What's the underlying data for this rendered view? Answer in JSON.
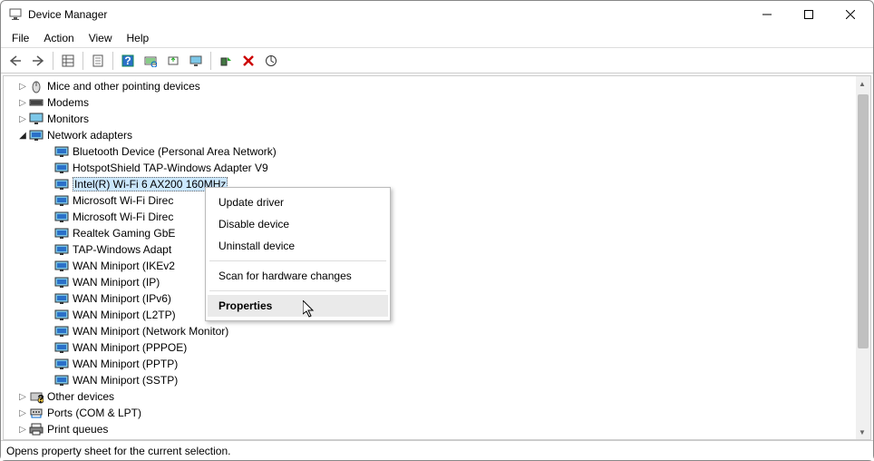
{
  "window": {
    "title": "Device Manager"
  },
  "menu": {
    "file": "File",
    "action": "Action",
    "view": "View",
    "help": "Help"
  },
  "tree": {
    "categories": [
      {
        "label": "Mice and other pointing devices",
        "expanded": false,
        "icon": "mouse"
      },
      {
        "label": "Modems",
        "expanded": false,
        "icon": "modem"
      },
      {
        "label": "Monitors",
        "expanded": false,
        "icon": "monitor"
      },
      {
        "label": "Network adapters",
        "expanded": true,
        "icon": "network",
        "children": [
          {
            "label": "Bluetooth Device (Personal Area Network)"
          },
          {
            "label": "HotspotShield TAP-Windows Adapter V9"
          },
          {
            "label": "Intel(R) Wi-Fi 6 AX200 160MHz",
            "selected": true
          },
          {
            "label": "Microsoft Wi-Fi Direc",
            "truncated": true
          },
          {
            "label": "Microsoft Wi-Fi Direc",
            "truncated": true
          },
          {
            "label": "Realtek Gaming GbE"
          },
          {
            "label": "TAP-Windows Adapt",
            "truncated": true
          },
          {
            "label": "WAN Miniport (IKEv2"
          },
          {
            "label": "WAN Miniport (IP)"
          },
          {
            "label": "WAN Miniport (IPv6)"
          },
          {
            "label": "WAN Miniport (L2TP)"
          },
          {
            "label": "WAN Miniport (Network Monitor)"
          },
          {
            "label": "WAN Miniport (PPPOE)"
          },
          {
            "label": "WAN Miniport (PPTP)"
          },
          {
            "label": "WAN Miniport (SSTP)"
          }
        ]
      },
      {
        "label": "Other devices",
        "expanded": false,
        "icon": "other"
      },
      {
        "label": "Ports (COM & LPT)",
        "expanded": false,
        "icon": "port"
      },
      {
        "label": "Print queues",
        "expanded": false,
        "icon": "printer"
      }
    ]
  },
  "context_menu": {
    "items": [
      {
        "label": "Update driver"
      },
      {
        "label": "Disable device"
      },
      {
        "label": "Uninstall device"
      },
      {
        "sep": true
      },
      {
        "label": "Scan for hardware changes"
      },
      {
        "sep": true
      },
      {
        "label": "Properties",
        "default": true,
        "hover": true
      }
    ]
  },
  "status": {
    "text": "Opens property sheet for the current selection."
  }
}
